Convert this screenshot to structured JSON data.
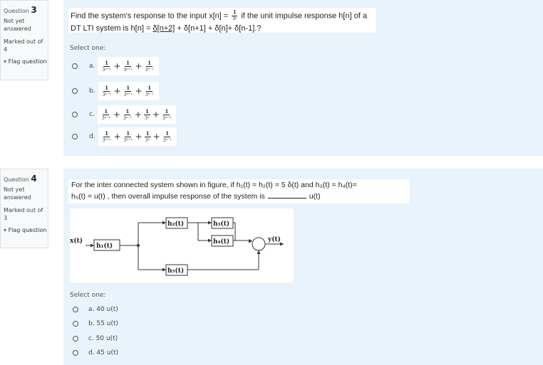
{
  "q3": {
    "label": "Question",
    "number": "3",
    "status": "Not yet answered",
    "marks": "Marked out of 4",
    "flag": "Flag question",
    "text_a": "Find the system's response to the input x[n] =",
    "frac_num": "1",
    "frac_den": "3ⁿ",
    "text_b": "if the unit impulse response h[n] of a",
    "text_c": "DT LTI system is h[n] =",
    "text_d": "δ[n+2]",
    "text_e": "+ δ[n+1] + δ[n]+ δ[n-1].?",
    "prompt": "Select one:",
    "options": [
      {
        "label": "a.",
        "terms": [
          "3ⁿ⁺³",
          "3ⁿ⁺¹",
          "3ⁿ⁻¹"
        ]
      },
      {
        "label": "b.",
        "terms": [
          "3ⁿ⁻³",
          "3ⁿ⁺¹",
          "3ⁿ⁻¹"
        ]
      },
      {
        "label": "c.",
        "terms": [
          "3ⁿ⁻²",
          "3ⁿ⁻¹",
          "3ⁿ",
          "3ⁿ⁺³"
        ]
      },
      {
        "label": "d.",
        "terms": [
          "3ⁿ⁺²",
          "3ⁿ⁺¹",
          "3ⁿ",
          "3ⁿ⁻¹"
        ]
      }
    ],
    "numerator": "1"
  },
  "q4": {
    "label": "Question",
    "number": "4",
    "status": "Not yet answered",
    "marks": "Marked out of 3",
    "flag": "Flag question",
    "line1": "For the inter connected system shown in figure, if h₁(t) = h₂(t) = 5 δ(t) and h₃(t) = h₄(t)=",
    "line2a": "h₅(t) = u(t) , then overall impulse response of the system is",
    "line2b": "u(t)",
    "diagram": {
      "input": "x(t)",
      "output": "y(t)",
      "h1": "h₁(t)",
      "h2": "h₂(t)",
      "h3": "h₃(t)",
      "h4": "h₄(t)",
      "h5": "h₅(t)"
    },
    "prompt": "Select one:",
    "options": [
      "a. 40 u(t)",
      "b. 55 u(t)",
      "c. 50 u(t)",
      "d. 45 u(t)"
    ]
  }
}
